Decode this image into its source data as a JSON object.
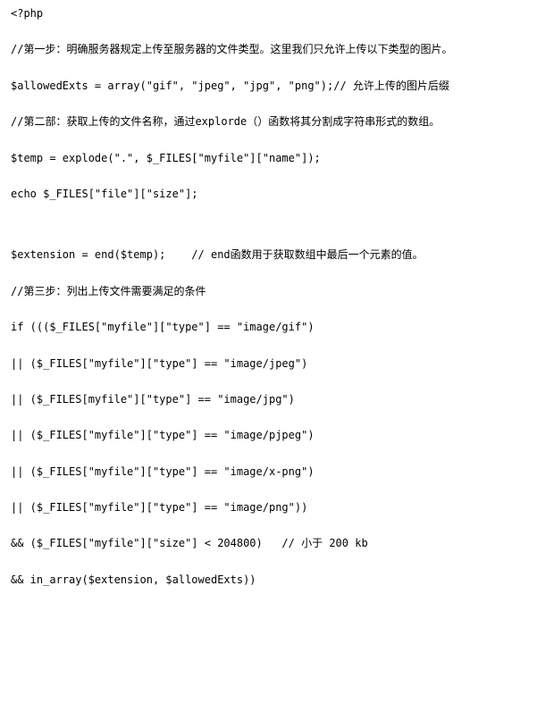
{
  "code": {
    "line1": "<?php",
    "line2": "//第一步：明确服务器规定上传至服务器的文件类型。这里我们只允许上传以下类型的图片。",
    "line3": "$allowedExts = array(\"gif\", \"jpeg\", \"jpg\", \"png\");// 允许上传的图片后缀",
    "line4": "//第二部：获取上传的文件名称，通过explorde（）函数将其分割成字符串形式的数组。",
    "line5": "$temp = explode(\".\", $_FILES[\"myfile\"][\"name\"]);",
    "line6": "echo $_FILES[\"file\"][\"size\"];",
    "line7": "$extension = end($temp);    // end函数用于获取数组中最后一个元素的值。",
    "line8": "//第三步：列出上传文件需要满足的条件",
    "line9": "if ((($_FILES[\"myfile\"][\"type\"] == \"image/gif\")",
    "line10": "|| ($_FILES[\"myfile\"][\"type\"] == \"image/jpeg\")",
    "line11": "|| ($_FILES[myfile\"][\"type\"] == \"image/jpg\")",
    "line12": "|| ($_FILES[\"myfile\"][\"type\"] == \"image/pjpeg\")",
    "line13": "|| ($_FILES[\"myfile\"][\"type\"] == \"image/x-png\")",
    "line14": "|| ($_FILES[\"myfile\"][\"type\"] == \"image/png\"))",
    "line15": "&& ($_FILES[\"myfile\"][\"size\"] < 204800)   // 小于 200 kb",
    "line16": "&& in_array($extension, $allowedExts))"
  }
}
